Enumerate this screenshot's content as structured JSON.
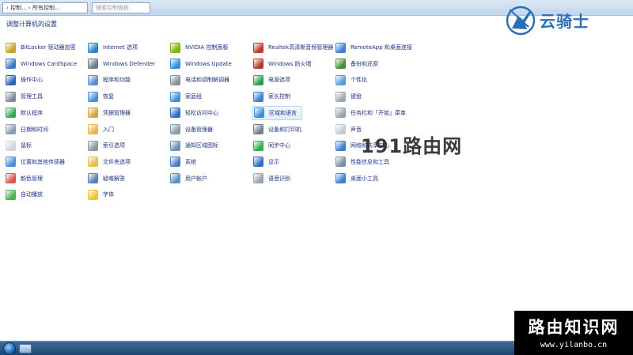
{
  "window": {
    "address_text": "› 控制... › 所有控制...",
    "search_placeholder": "搜索控制面板",
    "heading": "调整计算机的设置"
  },
  "logo": {
    "text": "云骑士"
  },
  "watermarks": {
    "mid": "191路由网",
    "box_title": "路由知识网",
    "box_url": "www.yilanbo.cn"
  },
  "columns": [
    [
      "BitLocker 驱动器加密",
      "Windows CardSpace",
      "操作中心",
      "管理工具",
      "默认程序",
      "日期和时间",
      "鼠标",
      "位置和其他传感器",
      "颜色管理",
      "自动播放"
    ],
    [
      "Internet 选项",
      "Windows Defender",
      "程序和功能",
      "恢复",
      "凭据管理器",
      "入门",
      "索引选项",
      "文件夹选项",
      "疑难解答",
      "字体"
    ],
    [
      "NVIDIA 控制面板",
      "Windows Update",
      "电话和调制解调器",
      "家庭组",
      "轻松访问中心",
      "设备管理器",
      "通知区域图标",
      "系统",
      "用户帐户"
    ],
    [
      "Realtek高清晰音频管理器",
      "Windows 防火墙",
      "电源选项",
      "家长控制",
      "区域和语言",
      "设备和打印机",
      "同步中心",
      "显示",
      "语音识别"
    ],
    [
      "RemoteApp 和桌面连接",
      "备份和还原",
      "个性化",
      "键盘",
      "任务栏和「开始」菜单",
      "声音",
      "网络和共享中心",
      "性能信息和工具",
      "桌面小工具"
    ]
  ],
  "icon_colors": [
    [
      "#c9a227",
      "#3b78c2",
      "#2f64b5",
      "#7f8c98",
      "#3aa655",
      "#8a9bb3",
      "#cfd5de",
      "#4f8fd1",
      "#d9534f",
      "#4caf50"
    ],
    [
      "#2e86c9",
      "#6c7a89",
      "#5a8fcf",
      "#4a90d9",
      "#d1a93a",
      "#e8b84a",
      "#8a95a5",
      "#e3c04f",
      "#5a7fb5",
      "#f1c232"
    ],
    [
      "#76b900",
      "#2f8fdb",
      "#8a9299",
      "#3e8fd8",
      "#2e6fc4",
      "#8c99a8",
      "#6f8fb8",
      "#4d7fbf",
      "#5b8fc7"
    ],
    [
      "#c0392b",
      "#b23a2b",
      "#2e9b4e",
      "#3f7fcf",
      "#3c8fd8",
      "#6f7f8f",
      "#2fb04e",
      "#2f6fc0",
      "#9aa4ad"
    ],
    [
      "#3f7fcf",
      "#4a8a3c",
      "#5a9cd8",
      "#a0a8b0",
      "#9aa3ad",
      "#c4c9cf",
      "#3f7fcf",
      "#7d8fa3",
      "#3d7fc9"
    ]
  ],
  "hovered_item": "区域和语言"
}
